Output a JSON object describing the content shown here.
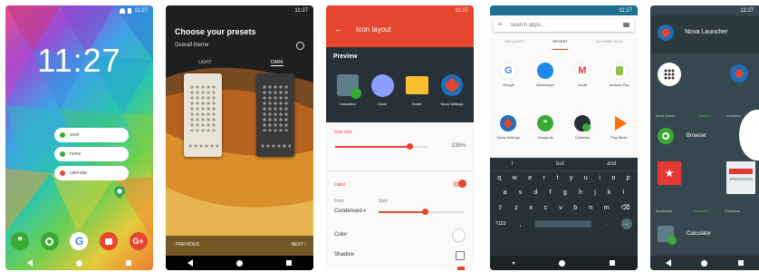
{
  "status": {
    "time": "11:27"
  },
  "p1": {
    "clock": "11:27",
    "widgets": [
      "work",
      "home",
      "calendar"
    ]
  },
  "p2": {
    "title": "Choose your presets",
    "subtitle": "Overall theme",
    "tab_light": "LIGHT",
    "tab_dark": "DARK",
    "prev": "PREVIOUS",
    "next": "NEXT"
  },
  "p3": {
    "title": "Icon layout",
    "preview": "Preview",
    "apps": [
      "Calculator",
      "Clock",
      "Email",
      "Nova Settings"
    ],
    "icon_size_label": "Icon size",
    "icon_size_value": "135%",
    "label_header": "Label",
    "font_label": "Font",
    "size_label": "Size",
    "font_value": "Condensed",
    "color_label": "Color",
    "shadow_label": "Shadow"
  },
  "p4": {
    "search_placeholder": "Search apps...",
    "tabs": [
      "FREQUENT",
      "RECENT",
      "ALPHABETICAL"
    ],
    "apps_row1": [
      "Google",
      "Messenger",
      "Gmail",
      "Android Pay"
    ],
    "apps_row2": [
      "Nova Settings",
      "Hangouts",
      "Calendar",
      "Play Music"
    ],
    "suggestions": [
      "I",
      "but",
      "and"
    ],
    "keys_row1": [
      "q",
      "w",
      "e",
      "r",
      "t",
      "y",
      "u",
      "i",
      "o",
      "p"
    ],
    "keys_row2": [
      "a",
      "s",
      "d",
      "f",
      "g",
      "h",
      "j",
      "k",
      "l"
    ],
    "keys_row3": [
      "z",
      "x",
      "c",
      "v",
      "b",
      "n",
      "m"
    ],
    "sym_key": "?123",
    "comma_key": ",",
    "period_key": "."
  },
  "p5": {
    "title": "Nova Launcher",
    "rows": [
      {
        "left": "Nova Action",
        "mid": "Disabled",
        "right": "Activities"
      },
      {
        "left": "Browser",
        "mid": "",
        "right": ""
      },
      {
        "left": "Bookmark",
        "mid": "Disabled",
        "right": "Shortcuts"
      },
      {
        "left": "Calculator",
        "mid": "",
        "right": ""
      }
    ]
  },
  "colors": {
    "nova_red": "#e6452f",
    "dark_bg": "#263238",
    "dock_green": "#3aaa35"
  }
}
